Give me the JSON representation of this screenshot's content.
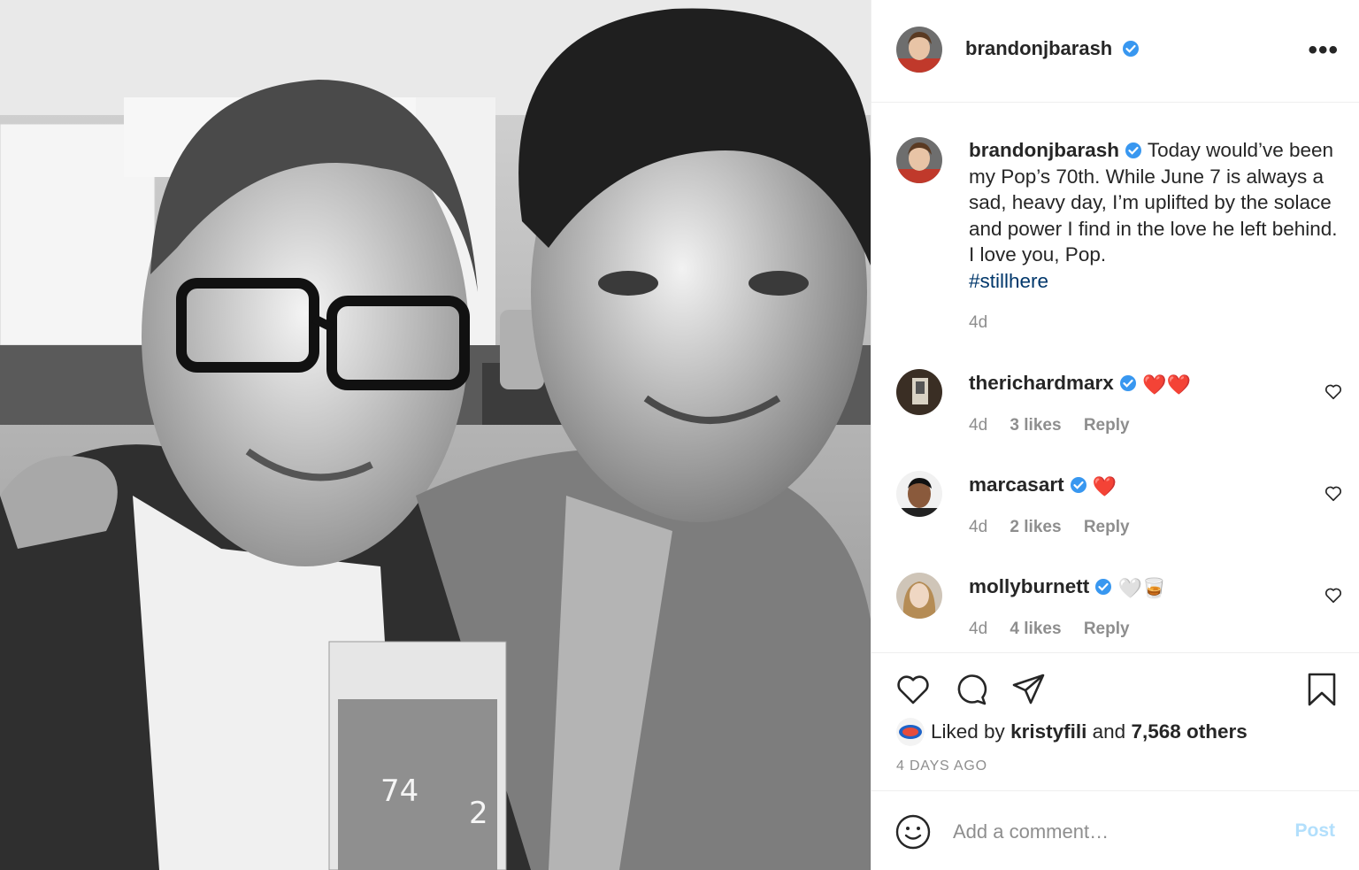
{
  "post": {
    "username": "brandonjbarash",
    "more_label": "•••",
    "caption_text": "Today would’ve been my Pop’s 70th. While June 7 is always a sad, heavy day, I’m uplifted by the solace and power I find in the love he left behind. I love you, Pop.",
    "hashtag": "#stillhere",
    "caption_time": "4d"
  },
  "comments": [
    {
      "username": "therichardmarx",
      "emoji": "❤️❤️",
      "time": "4d",
      "likes": "3 likes",
      "reply": "Reply"
    },
    {
      "username": "marcasart",
      "emoji": "❤️",
      "time": "4d",
      "likes": "2 likes",
      "reply": "Reply"
    },
    {
      "username": "mollyburnett",
      "emoji": "🤍🥃",
      "time": "4d",
      "likes": "4 likes",
      "reply": "Reply"
    }
  ],
  "likes": {
    "prefix": "Liked by",
    "first_liker": "kristyfili",
    "connector": "and",
    "others": "7,568 others",
    "ago": "4 DAYS AGO"
  },
  "add_comment": {
    "placeholder": "Add a comment…",
    "post_label": "Post"
  },
  "colors": {
    "verified": "#3897f0",
    "hashtag": "#00376b",
    "muted": "#8e8e8e",
    "post_disabled": "#b2dffc"
  },
  "icons": [
    "verified-badge-icon",
    "more-options-icon",
    "heart-icon",
    "comment-icon",
    "share-icon",
    "bookmark-icon",
    "emoji-smile-icon"
  ]
}
